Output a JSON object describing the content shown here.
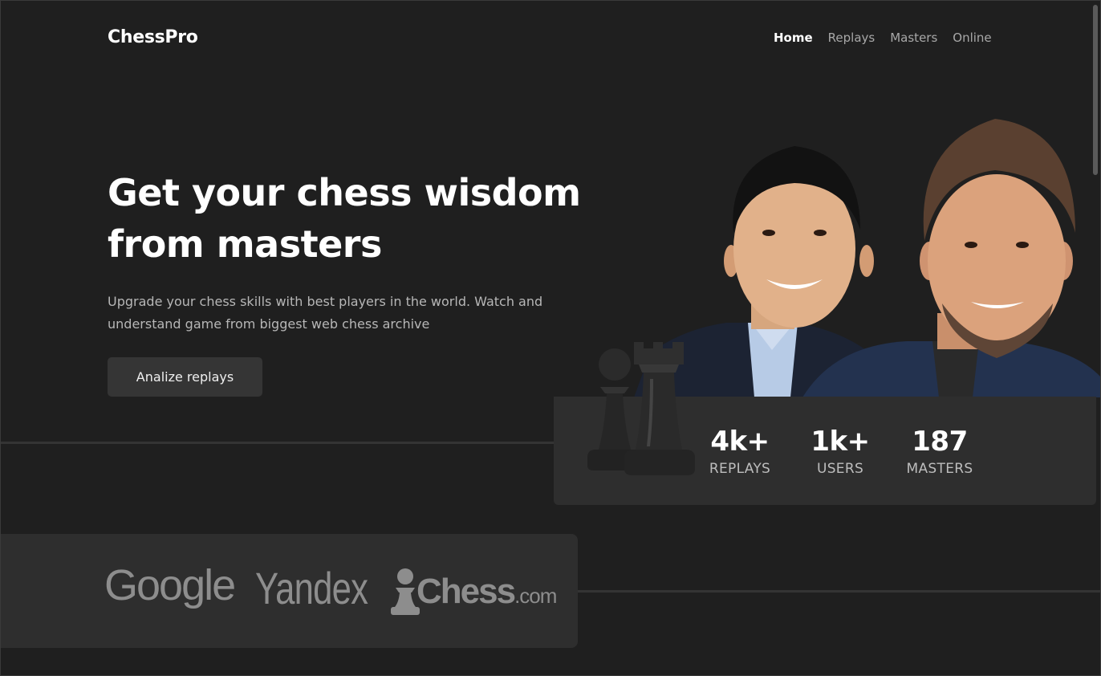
{
  "brand": "ChessPro",
  "nav": [
    {
      "label": "Home",
      "active": true
    },
    {
      "label": "Replays",
      "active": false
    },
    {
      "label": "Masters",
      "active": false
    },
    {
      "label": "Online",
      "active": false
    }
  ],
  "hero": {
    "title": "Get your chess wisdom from masters",
    "subtitle": "Upgrade your chess skills with best players in the world. Watch and understand game from  biggest web chess archive",
    "cta_label": "Analize replays"
  },
  "stats": [
    {
      "value": "4k+",
      "label": "REPLAYS"
    },
    {
      "value": "1k+",
      "label": "USERS"
    },
    {
      "value": "187",
      "label": "MASTERS"
    }
  ],
  "partners": {
    "google": "Google",
    "yandex": "Yandex",
    "chess_main": "Chess",
    "chess_suffix": ".com"
  },
  "colors": {
    "background": "#1f1f1f",
    "panel": "#2e2e2e",
    "button": "#353535",
    "muted_text": "#a8a8a8"
  }
}
